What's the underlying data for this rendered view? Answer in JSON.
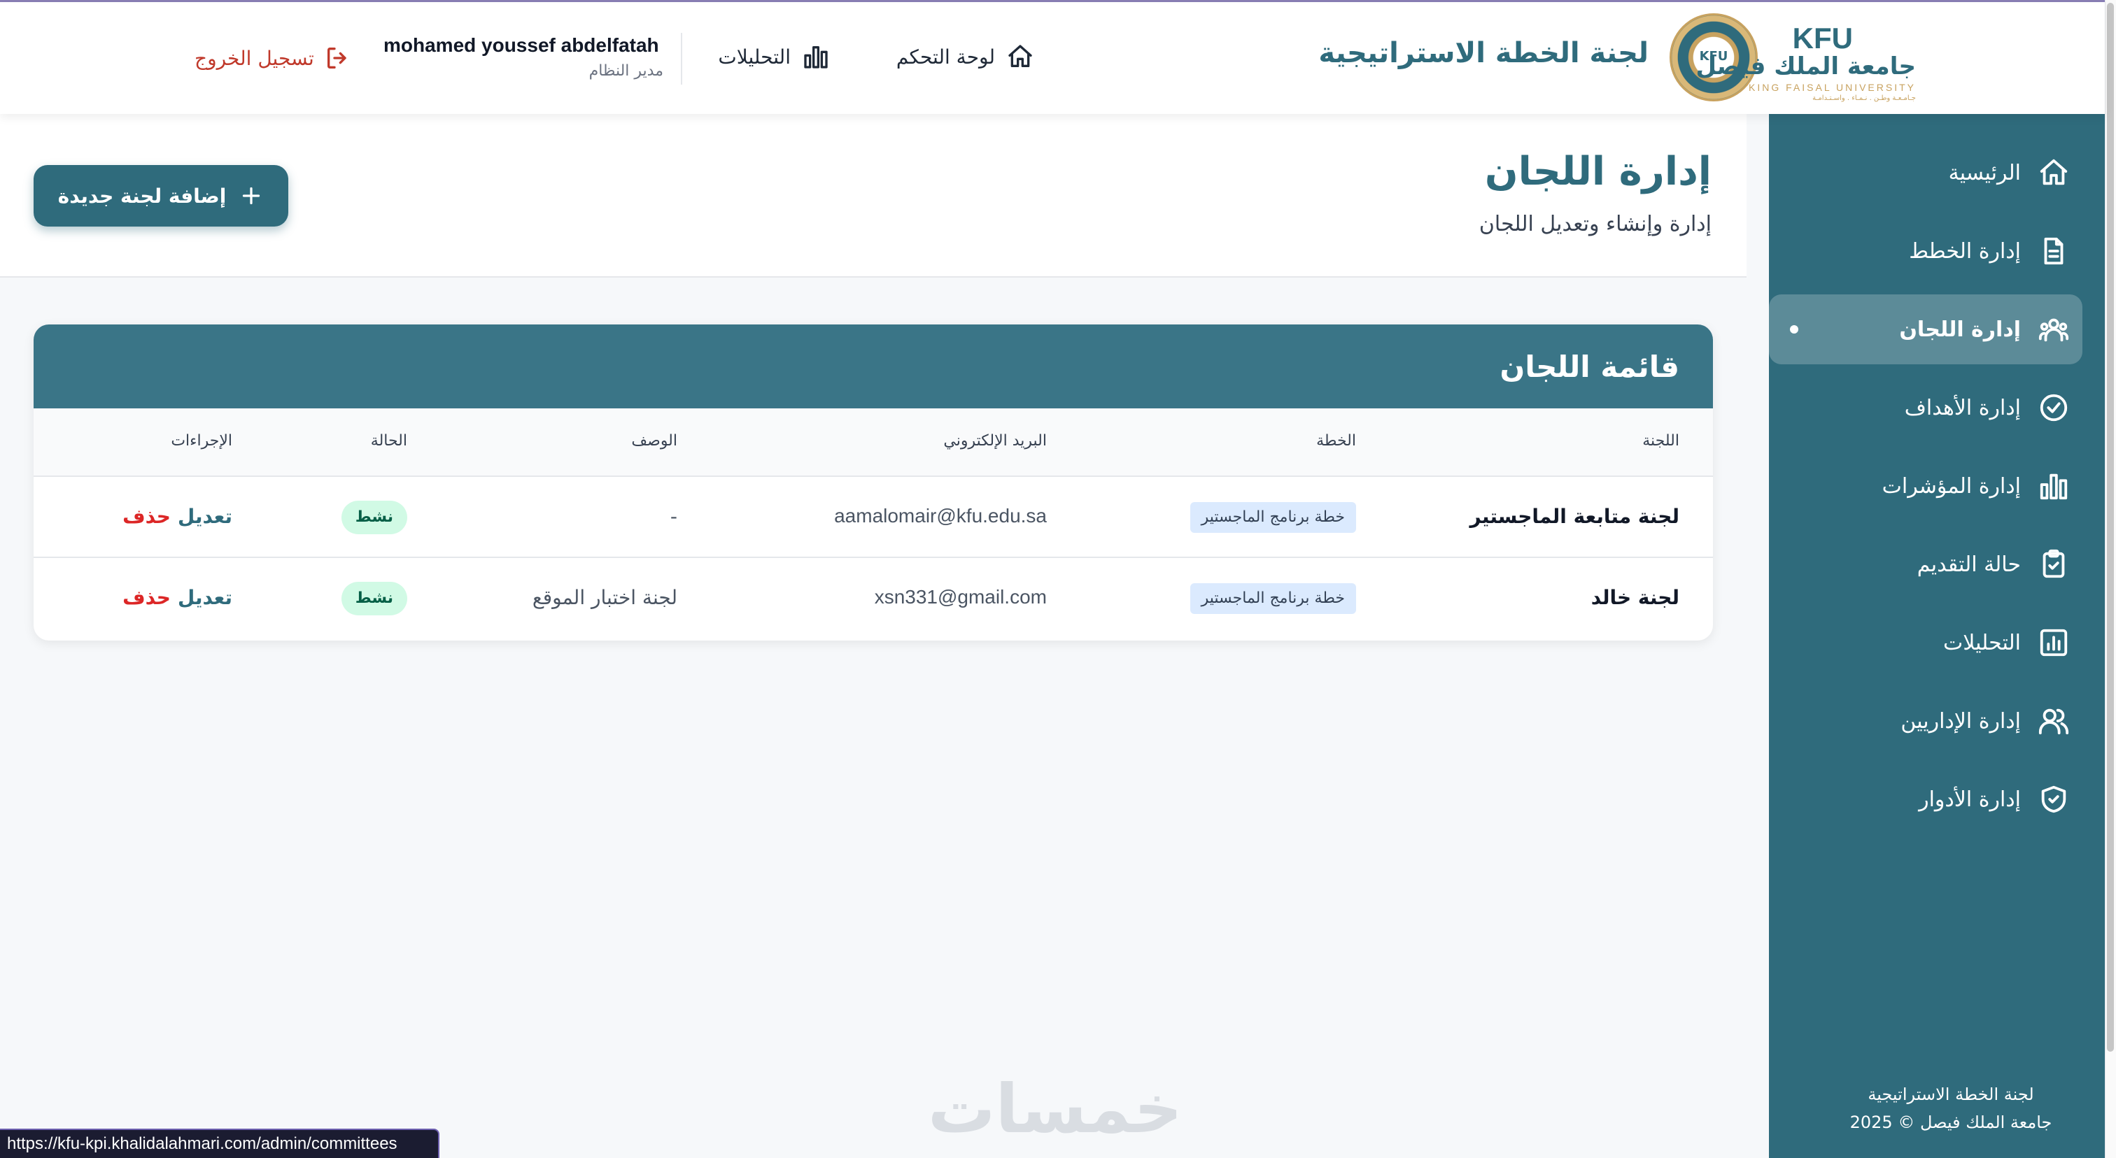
{
  "header": {
    "logo": {
      "kfu": "KFU",
      "arabic": "جامعة الملك فيصل",
      "english": "KING FAISAL UNIVERSITY",
      "tagline": "جـامـعـة وطـن . نـمـاء . واسـتـدامـة",
      "seal_text": "KFU"
    },
    "title": "لجنة الخطة الاستراتيجية",
    "nav": {
      "dashboard": "لوحة التحكم",
      "analytics": "التحليلات"
    },
    "user": {
      "name": "mohamed youssef abdelfatah",
      "role": "مدير النظام"
    },
    "logout": "تسجيل الخروج"
  },
  "sidebar": {
    "items": [
      {
        "label": "الرئيسية",
        "icon": "home-icon"
      },
      {
        "label": "إدارة الخطط",
        "icon": "document-icon"
      },
      {
        "label": "إدارة اللجان",
        "icon": "users-group-icon",
        "active": true
      },
      {
        "label": "إدارة الأهداف",
        "icon": "check-circle-icon"
      },
      {
        "label": "إدارة المؤشرات",
        "icon": "bar-chart-icon"
      },
      {
        "label": "حالة التقديم",
        "icon": "clipboard-check-icon"
      },
      {
        "label": "التحليلات",
        "icon": "analytics-icon"
      },
      {
        "label": "إدارة الإداريين",
        "icon": "users-icon"
      },
      {
        "label": "إدارة الأدوار",
        "icon": "shield-check-icon"
      }
    ],
    "footer": {
      "line1": "لجنة الخطة الاستراتيجية",
      "line2": "جامعة الملك فيصل © 2025"
    }
  },
  "page": {
    "title": "إدارة اللجان",
    "subtitle": "إدارة وإنشاء وتعديل اللجان",
    "add_button": "إضافة لجنة جديدة"
  },
  "table": {
    "title": "قائمة اللجان",
    "columns": [
      "اللجنة",
      "الخطة",
      "البريد الإلكتروني",
      "الوصف",
      "الحالة",
      "الإجراءات"
    ],
    "rows": [
      {
        "name": "لجنة متابعة الماجستير",
        "plan": "خطة برنامج الماجستير",
        "email": "aamalomair@kfu.edu.sa",
        "description": "-",
        "status": "نشط",
        "edit": "تعديل",
        "delete": "حذف"
      },
      {
        "name": "لجنة خالد",
        "plan": "خطة برنامج الماجستير",
        "email": "xsn331@gmail.com",
        "description": "لجنة اختبار الموقع",
        "status": "نشط",
        "edit": "تعديل",
        "delete": "حذف"
      }
    ]
  },
  "watermark": "خمسات",
  "status_url": "https://kfu-kpi.khalidalahmari.com/admin/committees",
  "colors": {
    "primary": "#2f6b7c",
    "danger": "#dc2626",
    "success_bg": "#d1fae5",
    "plan_bg": "#dbeafe"
  }
}
